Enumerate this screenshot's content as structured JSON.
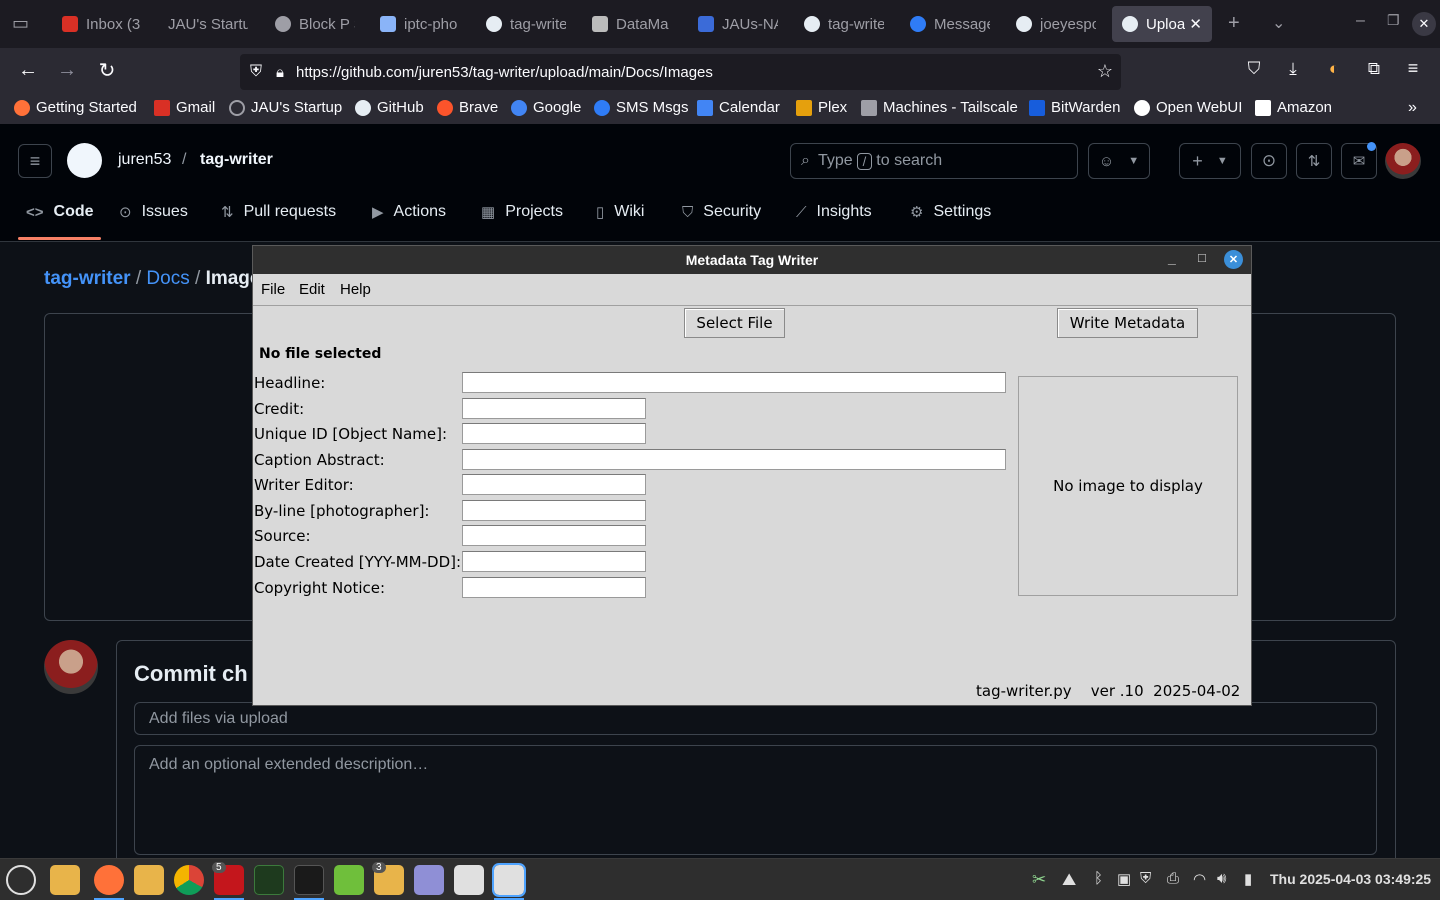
{
  "browser": {
    "tabs": [
      {
        "label": "Inbox (3",
        "color": "#d93025"
      },
      {
        "label": "JAU's Startu",
        "color": "#9e9ea6"
      },
      {
        "label": "Block P S",
        "color": "#9e9ea6"
      },
      {
        "label": "iptc-pho",
        "color": "#8ab4f8"
      },
      {
        "label": "tag-write",
        "color": "#e6edf3"
      },
      {
        "label": "DataMa",
        "color": "#bbbbbb"
      },
      {
        "label": "JAUs-NA",
        "color": "#3b6bd8"
      },
      {
        "label": "tag-write",
        "color": "#e6edf3"
      },
      {
        "label": "Message",
        "color": "#2f7cf6"
      },
      {
        "label": "joeyespo",
        "color": "#e6edf3"
      },
      {
        "label": "Uploa",
        "color": "#e6edf3",
        "active": true
      }
    ],
    "url": "https://github.com/juren53/tag-writer/upload/main/Docs/Images",
    "bookmarks": [
      {
        "label": "Getting Started",
        "color": "#ff7139"
      },
      {
        "label": "Gmail",
        "color": "#d93025"
      },
      {
        "label": "JAU's Startup",
        "color": "#9e9ea6"
      },
      {
        "label": "GitHub",
        "color": "#e6edf3"
      },
      {
        "label": "Brave",
        "color": "#fb542b"
      },
      {
        "label": "Google",
        "color": "#4285f4"
      },
      {
        "label": "SMS Msgs",
        "color": "#2f7cf6"
      },
      {
        "label": "Calendar",
        "color": "#4285f4"
      },
      {
        "label": "Plex",
        "color": "#e5a00d"
      },
      {
        "label": "Machines - Tailscale",
        "color": "#9e9ea6"
      },
      {
        "label": "BitWarden",
        "color": "#175ddc"
      },
      {
        "label": "Open WebUI",
        "color": "#ffffff"
      },
      {
        "label": "Amazon",
        "color": "#ffffff"
      }
    ]
  },
  "github": {
    "owner": "juren53",
    "separator": "/",
    "repo": "tag-writer",
    "search_prefix": "Type",
    "search_key": "/",
    "search_suffix": "to search",
    "nav": [
      "Code",
      "Issues",
      "Pull requests",
      "Actions",
      "Projects",
      "Wiki",
      "Security",
      "Insights",
      "Settings"
    ],
    "breadcrumb": {
      "repo": "tag-writer",
      "sep": "/",
      "dir": "Docs",
      "current": "Images"
    },
    "commit_title": "Commit ch",
    "commit_summary_placeholder": "Add files via upload",
    "commit_description_placeholder": "Add an optional extended description…"
  },
  "tkapp": {
    "title": "Metadata Tag Writer",
    "menu": [
      "File",
      "Edit",
      "Help"
    ],
    "select_file_button": "Select File",
    "write_metadata_button": "Write Metadata",
    "status": "No file selected",
    "fields": [
      {
        "label": "Headline:",
        "value": ""
      },
      {
        "label": "Credit:",
        "value": ""
      },
      {
        "label": "Unique ID [Object Name]:",
        "value": ""
      },
      {
        "label": "Caption Abstract:",
        "value": ""
      },
      {
        "label": "Writer Editor:",
        "value": ""
      },
      {
        "label": "By-line [photographer]:",
        "value": ""
      },
      {
        "label": "Source:",
        "value": ""
      },
      {
        "label": "Date Created [YYY-MM-DD]:",
        "value": ""
      },
      {
        "label": "Copyright Notice:",
        "value": ""
      }
    ],
    "image_placeholder": "No image to display",
    "footer": "tag-writer.py    ver .10  2025-04-02"
  },
  "taskbar": {
    "badge_terminal": "5",
    "badge_files": "3",
    "clock": "Thu 2025-04-03 03:49:25"
  }
}
